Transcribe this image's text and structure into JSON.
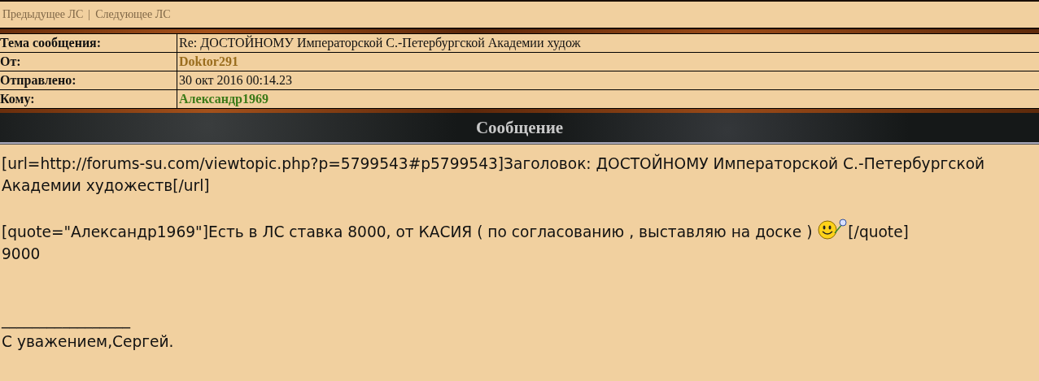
{
  "nav": {
    "previous": "Предыдущее ЛС",
    "separator": "|",
    "next": "Следующее ЛС"
  },
  "header_rows": [
    {
      "label": "Тема сообщения:",
      "value": "Re: ДОСТОЙНОМУ Императорской С.-Петербургской Академии худож",
      "kind": "plain"
    },
    {
      "label": "От:",
      "value": "Doktor291",
      "kind": "sender"
    },
    {
      "label": "Отправлено:",
      "value": "30 окт 2016 00:14.23",
      "kind": "plain"
    },
    {
      "label": "Кому:",
      "value": "Александр1969",
      "kind": "recipient"
    }
  ],
  "section_title": "Сообщение",
  "message": {
    "link_line": "[url=http://forums-su.com/viewtopic.php?p=5799543#p5799543]Заголовок: ДОСТОЙНОМУ Императорской С.-Петербургской Академии художеств[/url]",
    "quote_before": "[quote=\"Александр1969\"]Есть в ЛС ставка 8000, от КАСИЯ ( по согласованию , выставляю на доске )",
    "quote_after": "[/quote]",
    "reply": "9000",
    "separator_line": "_________________",
    "signature": "С уважением,Сергей."
  }
}
